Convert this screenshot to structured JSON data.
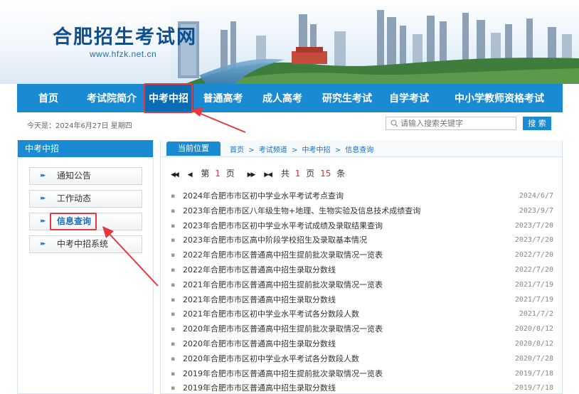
{
  "site": {
    "title": "合肥招生考试网",
    "url": "www.hfzk.net.cn"
  },
  "nav": [
    {
      "label": "首页",
      "active": false
    },
    {
      "label": "考试院简介",
      "active": false
    },
    {
      "label": "中考中招",
      "active": true
    },
    {
      "label": "普通高考",
      "active": false
    },
    {
      "label": "成人高考",
      "active": false
    },
    {
      "label": "研究生考试",
      "active": false
    },
    {
      "label": "自学考试",
      "active": false
    },
    {
      "label": "中小学教师资格考试",
      "active": false
    }
  ],
  "today": "今天是：2024年6月27日  星期四",
  "search": {
    "placeholder": "请输入搜索关键字",
    "button": "搜 索"
  },
  "sidebar": {
    "title": "中考中招",
    "items": [
      {
        "label": "通知公告"
      },
      {
        "label": "工作动态"
      },
      {
        "label": "信息查询"
      },
      {
        "label": "中考中招系统"
      }
    ]
  },
  "location": {
    "label": "当前位置",
    "crumbs": [
      "首页",
      ">",
      "考试频道",
      ">",
      "中考中招",
      ">",
      "信息查询"
    ]
  },
  "pager": {
    "first": "◀◀",
    "prev": "◀",
    "page_pre": "第",
    "page": "1",
    "page_post": "页",
    "next": "▶▶",
    "last": "▶◀",
    "total_pre": "共",
    "total_pages": "1",
    "total_mid": "页",
    "total_items": "15",
    "total_post": "条"
  },
  "list": [
    {
      "title": "2024年合肥市市区初中学业水平考试考点查询",
      "date": "2024/6/7"
    },
    {
      "title": "2023年合肥市市区八年级生物+地理、生物实验及信息技术成绩查询",
      "date": "2023/9/7"
    },
    {
      "title": "2023年合肥市市区初中学业水平考试成绩及录取结果查询",
      "date": "2023/7/20"
    },
    {
      "title": "2023年合肥市市区高中阶段学校招生及录取基本情况",
      "date": "2023/7/20"
    },
    {
      "title": "2022年合肥市市区普通高中招生提前批次录取情况一览表",
      "date": "2022/7/20"
    },
    {
      "title": "2022年合肥市市区普通高中招生录取分数线",
      "date": "2022/7/20"
    },
    {
      "title": "2021年合肥市市区普通高中招生提前批次录取情况一览表",
      "date": "2021/7/19"
    },
    {
      "title": "2021年合肥市市区普通高中招生录取分数线",
      "date": "2021/7/19"
    },
    {
      "title": "2021年合肥市市区初中学业水平考试各分数段人数",
      "date": "2021/7/2"
    },
    {
      "title": "2020年合肥市市区普通高中招生提前批次录取情况一览表",
      "date": "2020/8/12"
    },
    {
      "title": "2020年合肥市市区普通高中招生录取分数线",
      "date": "2020/8/12"
    },
    {
      "title": "2020年合肥市市区初中学业水平考试各分数段人数",
      "date": "2020/7/28"
    },
    {
      "title": "2019年合肥市市区普通高中招生提前批次录取情况一览表",
      "date": "2019/7/18"
    },
    {
      "title": "2019年合肥市市区普通高中招生录取分数线",
      "date": "2019/7/18"
    }
  ],
  "colors": {
    "nav_blue": "#1a8bd3",
    "highlight_red": "#e8383d",
    "link_blue": "#1a6fc0"
  }
}
